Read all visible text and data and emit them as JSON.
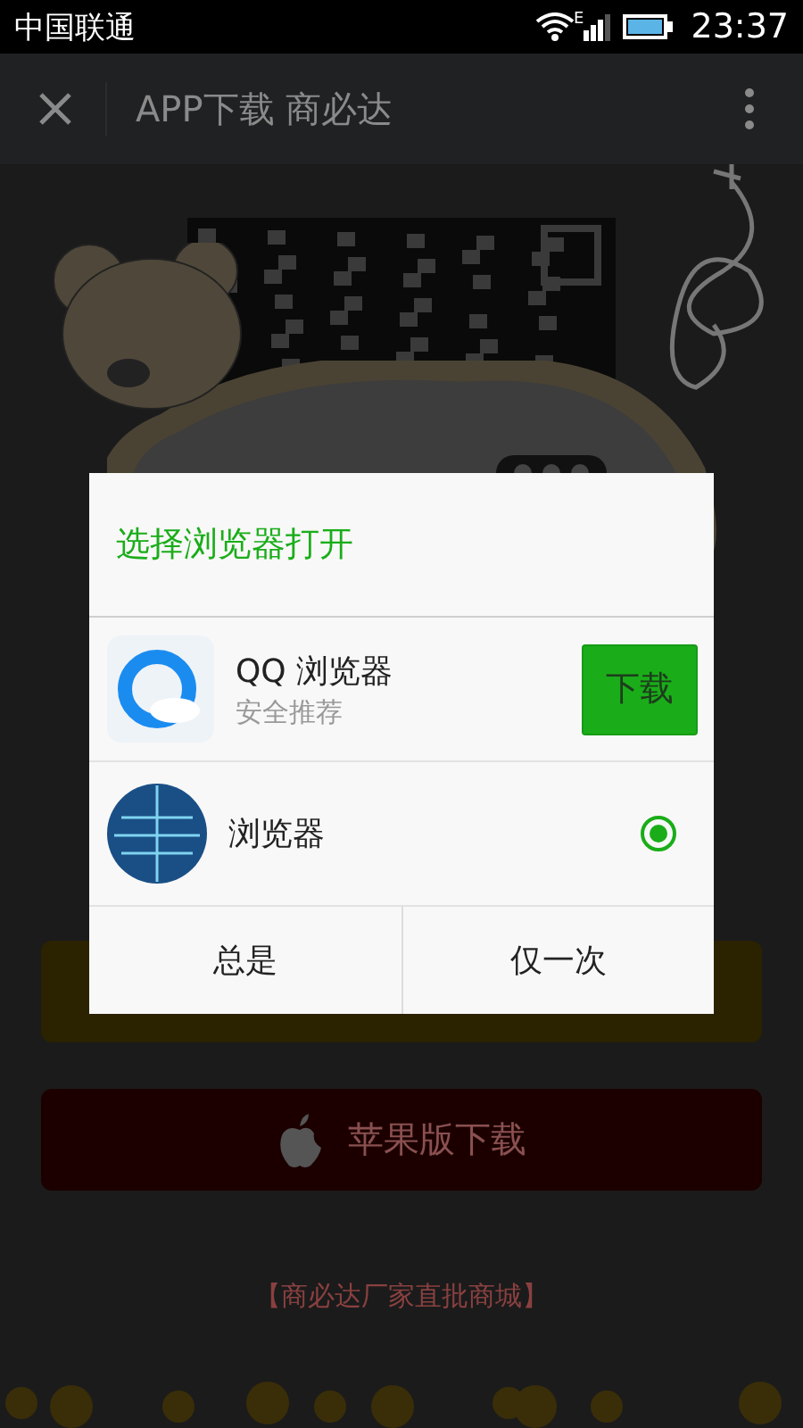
{
  "status_bar": {
    "carrier": "中国联通",
    "network": "E",
    "time": "23:37"
  },
  "toolbar": {
    "title": "APP下载 商必达"
  },
  "page": {
    "apple_button": {
      "label": "苹果版下载"
    },
    "footer": "【商必达厂家直批商城】"
  },
  "dialog": {
    "title": "选择浏览器打开",
    "options": [
      {
        "kind": "download",
        "name": "QQ 浏览器",
        "subtitle": "安全推荐",
        "action": "下载"
      },
      {
        "kind": "installed",
        "name": "浏览器",
        "selected": true
      }
    ],
    "buttons": [
      "总是",
      "仅一次"
    ]
  }
}
